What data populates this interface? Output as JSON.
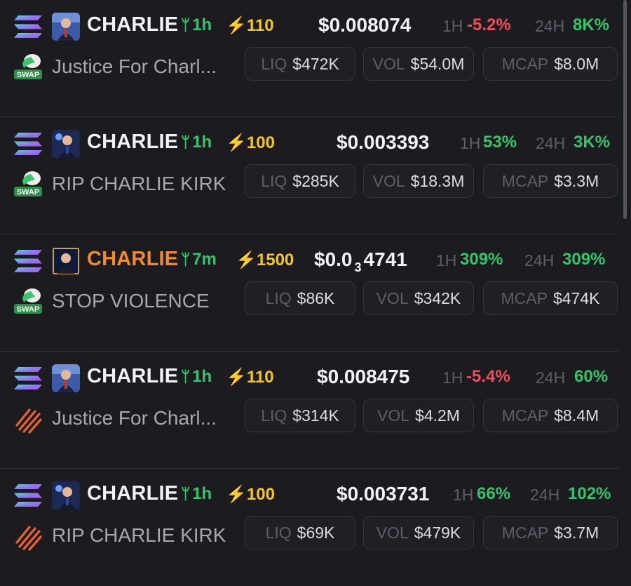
{
  "rows": [
    {
      "ticker": "CHARLIE",
      "age": "1h",
      "score": "110",
      "price_main": "$0.008074",
      "price_sub": "",
      "price_tail": "",
      "h1_label": "1H",
      "h1": "-5.2%",
      "h1_dir": "neg",
      "h24_label": "24H",
      "h24": "8K%",
      "h24_dir": "pos",
      "description": "Justice For Charl...",
      "dex": "swap",
      "liq_label": "LIQ",
      "liq": "$472K",
      "vol_label": "VOL",
      "vol": "$54.0M",
      "mcap_label": "MCAP",
      "mcap": "$8.0M",
      "ticker_color": "white"
    },
    {
      "ticker": "CHARLIE",
      "age": "1h",
      "score": "100",
      "price_main": "$0.003393",
      "price_sub": "",
      "price_tail": "",
      "h1_label": "1H",
      "h1": "53%",
      "h1_dir": "pos",
      "h24_label": "24H",
      "h24": "3K%",
      "h24_dir": "pos",
      "description": "RIP CHARLIE KIRK",
      "dex": "swap",
      "liq_label": "LIQ",
      "liq": "$285K",
      "vol_label": "VOL",
      "vol": "$18.3M",
      "mcap_label": "MCAP",
      "mcap": "$3.3M",
      "ticker_color": "white"
    },
    {
      "ticker": "CHARLIE",
      "age": "7m",
      "score": "1500",
      "price_main": "$0.0",
      "price_sub": "3",
      "price_tail": "4741",
      "h1_label": "1H",
      "h1": "309%",
      "h1_dir": "pos",
      "h24_label": "24H",
      "h24": "309%",
      "h24_dir": "pos",
      "description": "STOP VIOLENCE",
      "dex": "swap",
      "liq_label": "LIQ",
      "liq": "$86K",
      "vol_label": "VOL",
      "vol": "$342K",
      "mcap_label": "MCAP",
      "mcap": "$474K",
      "ticker_color": "orange"
    },
    {
      "ticker": "CHARLIE",
      "age": "1h",
      "score": "110",
      "price_main": "$0.008475",
      "price_sub": "",
      "price_tail": "",
      "h1_label": "1H",
      "h1": "-5.4%",
      "h1_dir": "neg",
      "h24_label": "24H",
      "h24": "60%",
      "h24_dir": "pos",
      "description": "Justice For Charl...",
      "dex": "orange-stripes",
      "liq_label": "LIQ",
      "liq": "$314K",
      "vol_label": "VOL",
      "vol": "$4.2M",
      "mcap_label": "MCAP",
      "mcap": "$8.4M",
      "ticker_color": "white"
    },
    {
      "ticker": "CHARLIE",
      "age": "1h",
      "score": "100",
      "price_main": "$0.003731",
      "price_sub": "",
      "price_tail": "",
      "h1_label": "1H",
      "h1": "66%",
      "h1_dir": "pos",
      "h24_label": "24H",
      "h24": "102%",
      "h24_dir": "pos",
      "description": "RIP CHARLIE KIRK",
      "dex": "orange-stripes",
      "liq_label": "LIQ",
      "liq": "$69K",
      "vol_label": "VOL",
      "vol": "$479K",
      "mcap_label": "MCAP",
      "mcap": "$3.7M",
      "ticker_color": "white"
    }
  ],
  "dex_badge_text": "SWAP",
  "icons": {
    "chain": "solana-icon",
    "age": "sprout-icon",
    "score": "lightning-icon",
    "dex_swap": "swap-dex-icon",
    "dex_orange": "orange-stripes-dex-icon"
  },
  "colors": {
    "positive": "#35c46a",
    "negative": "#ef4e5a",
    "score": "#f3c623",
    "highlight_ticker": "#f08a2d"
  }
}
